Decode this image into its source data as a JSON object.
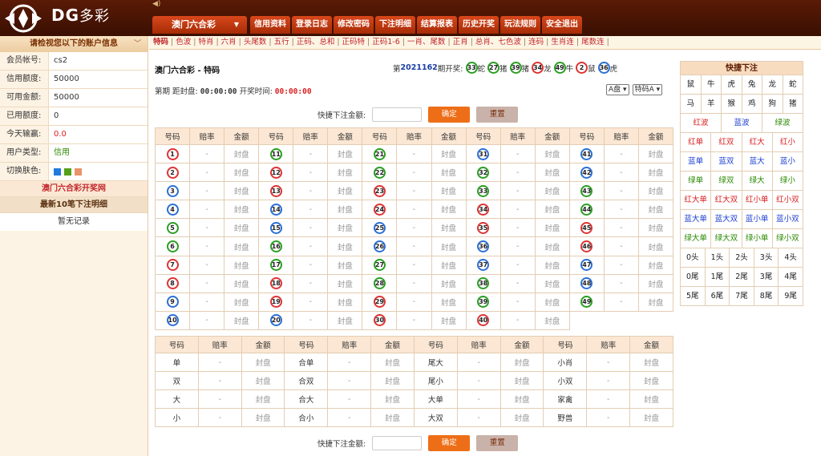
{
  "brand": {
    "latin": "DG",
    "cn": "多彩"
  },
  "game_select": "澳门六合彩",
  "top_nav": [
    "信用资料",
    "登录日志",
    "修改密码",
    "下注明细",
    "结算报表",
    "历史开奖",
    "玩法规则",
    "安全退出"
  ],
  "sub_nav": [
    "特码",
    "色波",
    "特肖",
    "六肖",
    "头尾数",
    "五行",
    "正码、总和",
    "正码特",
    "正码1-6",
    "一肖、尾数",
    "正肖",
    "总肖、七色波",
    "连码",
    "生肖连",
    "尾数连"
  ],
  "sidebar": {
    "header": "请检视您以下的账户信息",
    "rows": [
      {
        "k": "会员帐号:",
        "v": "cs2"
      },
      {
        "k": "信用额度:",
        "v": "50000"
      },
      {
        "k": "可用金额:",
        "v": "50000"
      },
      {
        "k": "已用额度:",
        "v": "0"
      },
      {
        "k": "今天输赢:",
        "v": "0.0"
      },
      {
        "k": "用户类型:",
        "v": "信用"
      },
      {
        "k": "切换肤色:",
        "v": ""
      }
    ],
    "swatch_colors": [
      "#1f7be0",
      "#55a019",
      "#e8946a"
    ],
    "lottery_link": "澳门六合彩开奖网",
    "recent_title": "最新10笔下注明细",
    "empty": "暂无记录"
  },
  "main": {
    "title": "澳门六合彩 - 特码",
    "draw_prefix": "第",
    "draw_period": "2021162",
    "draw_suffix": "期开奖:",
    "draw": [
      {
        "n": "33",
        "zodiac": "蛇",
        "color": "green"
      },
      {
        "n": "27",
        "zodiac": "猪",
        "color": "green"
      },
      {
        "n": "39",
        "zodiac": "猪",
        "color": "green"
      },
      {
        "n": "34",
        "zodiac": "龙",
        "color": "red"
      },
      {
        "n": "49",
        "zodiac": "牛",
        "color": "green"
      },
      {
        "n": "2",
        "zodiac": "鼠",
        "color": "red"
      },
      {
        "n": "36",
        "zodiac": "虎",
        "color": "blue"
      }
    ],
    "timer_label": "第期 距封盘:",
    "timer_value": "00:00:00",
    "open_label": "开奖时间:",
    "open_value": "00:00:00",
    "select_pan": "A盘",
    "select_type": "特码A",
    "quick_label": "快捷下注金额:",
    "confirm": "确定",
    "reset": "重置",
    "headers": [
      "号码",
      "赔率",
      "金额"
    ],
    "odds_placeholder": "-",
    "closed": "封盘",
    "numbers": [
      {
        "n": "1",
        "c": "red"
      },
      {
        "n": "2",
        "c": "red"
      },
      {
        "n": "3",
        "c": "blue"
      },
      {
        "n": "4",
        "c": "blue"
      },
      {
        "n": "5",
        "c": "green"
      },
      {
        "n": "6",
        "c": "green"
      },
      {
        "n": "7",
        "c": "red"
      },
      {
        "n": "8",
        "c": "red"
      },
      {
        "n": "9",
        "c": "blue"
      },
      {
        "n": "10",
        "c": "blue"
      },
      {
        "n": "11",
        "c": "green"
      },
      {
        "n": "12",
        "c": "red"
      },
      {
        "n": "13",
        "c": "red"
      },
      {
        "n": "14",
        "c": "blue"
      },
      {
        "n": "15",
        "c": "blue"
      },
      {
        "n": "16",
        "c": "green"
      },
      {
        "n": "17",
        "c": "green"
      },
      {
        "n": "18",
        "c": "red"
      },
      {
        "n": "19",
        "c": "red"
      },
      {
        "n": "20",
        "c": "blue"
      },
      {
        "n": "21",
        "c": "green"
      },
      {
        "n": "22",
        "c": "green"
      },
      {
        "n": "23",
        "c": "red"
      },
      {
        "n": "24",
        "c": "red"
      },
      {
        "n": "25",
        "c": "blue"
      },
      {
        "n": "26",
        "c": "blue"
      },
      {
        "n": "27",
        "c": "green"
      },
      {
        "n": "28",
        "c": "green"
      },
      {
        "n": "29",
        "c": "red"
      },
      {
        "n": "30",
        "c": "red"
      },
      {
        "n": "31",
        "c": "blue"
      },
      {
        "n": "32",
        "c": "green"
      },
      {
        "n": "33",
        "c": "green"
      },
      {
        "n": "34",
        "c": "red"
      },
      {
        "n": "35",
        "c": "red"
      },
      {
        "n": "36",
        "c": "blue"
      },
      {
        "n": "37",
        "c": "blue"
      },
      {
        "n": "38",
        "c": "green"
      },
      {
        "n": "39",
        "c": "green"
      },
      {
        "n": "40",
        "c": "red"
      },
      {
        "n": "41",
        "c": "blue"
      },
      {
        "n": "42",
        "c": "blue"
      },
      {
        "n": "43",
        "c": "green"
      },
      {
        "n": "44",
        "c": "green"
      },
      {
        "n": "45",
        "c": "red"
      },
      {
        "n": "46",
        "c": "red"
      },
      {
        "n": "47",
        "c": "blue"
      },
      {
        "n": "48",
        "c": "blue"
      },
      {
        "n": "49",
        "c": "green"
      }
    ],
    "misc_rows": [
      [
        "单",
        "合单",
        "尾大",
        "小肖"
      ],
      [
        "双",
        "合双",
        "尾小",
        "小双"
      ],
      [
        "大",
        "合大",
        "大单",
        "家禽"
      ],
      [
        "小",
        "合小",
        "大双",
        "野兽"
      ]
    ]
  },
  "quickbet": {
    "title": "快捷下注",
    "rows": [
      [
        {
          "t": "鼠",
          "c": "k"
        },
        {
          "t": "牛",
          "c": "k"
        },
        {
          "t": "虎",
          "c": "k"
        },
        {
          "t": "兔",
          "c": "k"
        },
        {
          "t": "龙",
          "c": "k"
        },
        {
          "t": "蛇",
          "c": "k"
        }
      ],
      [
        {
          "t": "马",
          "c": "k"
        },
        {
          "t": "羊",
          "c": "k"
        },
        {
          "t": "猴",
          "c": "k"
        },
        {
          "t": "鸡",
          "c": "k"
        },
        {
          "t": "狗",
          "c": "k"
        },
        {
          "t": "猪",
          "c": "k"
        }
      ],
      [
        {
          "t": "红波",
          "c": "r"
        },
        {
          "t": "蓝波",
          "c": "b"
        },
        {
          "t": "绿波",
          "c": "g"
        }
      ],
      [
        {
          "t": "红单",
          "c": "r"
        },
        {
          "t": "红双",
          "c": "r"
        },
        {
          "t": "红大",
          "c": "r"
        },
        {
          "t": "红小",
          "c": "r"
        }
      ],
      [
        {
          "t": "蓝单",
          "c": "b"
        },
        {
          "t": "蓝双",
          "c": "b"
        },
        {
          "t": "蓝大",
          "c": "b"
        },
        {
          "t": "蓝小",
          "c": "b"
        }
      ],
      [
        {
          "t": "绿单",
          "c": "g"
        },
        {
          "t": "绿双",
          "c": "g"
        },
        {
          "t": "绿大",
          "c": "g"
        },
        {
          "t": "绿小",
          "c": "g"
        }
      ],
      [
        {
          "t": "红大单",
          "c": "r"
        },
        {
          "t": "红大双",
          "c": "r"
        },
        {
          "t": "红小单",
          "c": "r"
        },
        {
          "t": "红小双",
          "c": "r"
        }
      ],
      [
        {
          "t": "蓝大单",
          "c": "b"
        },
        {
          "t": "蓝大双",
          "c": "b"
        },
        {
          "t": "蓝小单",
          "c": "b"
        },
        {
          "t": "蓝小双",
          "c": "b"
        }
      ],
      [
        {
          "t": "绿大单",
          "c": "g"
        },
        {
          "t": "绿大双",
          "c": "g"
        },
        {
          "t": "绿小单",
          "c": "g"
        },
        {
          "t": "绿小双",
          "c": "g"
        }
      ],
      [
        {
          "t": "0头",
          "c": "k"
        },
        {
          "t": "1头",
          "c": "k"
        },
        {
          "t": "2头",
          "c": "k"
        },
        {
          "t": "3头",
          "c": "k"
        },
        {
          "t": "4头",
          "c": "k"
        }
      ],
      [
        {
          "t": "0尾",
          "c": "k"
        },
        {
          "t": "1尾",
          "c": "k"
        },
        {
          "t": "2尾",
          "c": "k"
        },
        {
          "t": "3尾",
          "c": "k"
        },
        {
          "t": "4尾",
          "c": "k"
        }
      ],
      [
        {
          "t": "5尾",
          "c": "k"
        },
        {
          "t": "6尾",
          "c": "k"
        },
        {
          "t": "7尾",
          "c": "k"
        },
        {
          "t": "8尾",
          "c": "k"
        },
        {
          "t": "9尾",
          "c": "k"
        }
      ]
    ]
  }
}
